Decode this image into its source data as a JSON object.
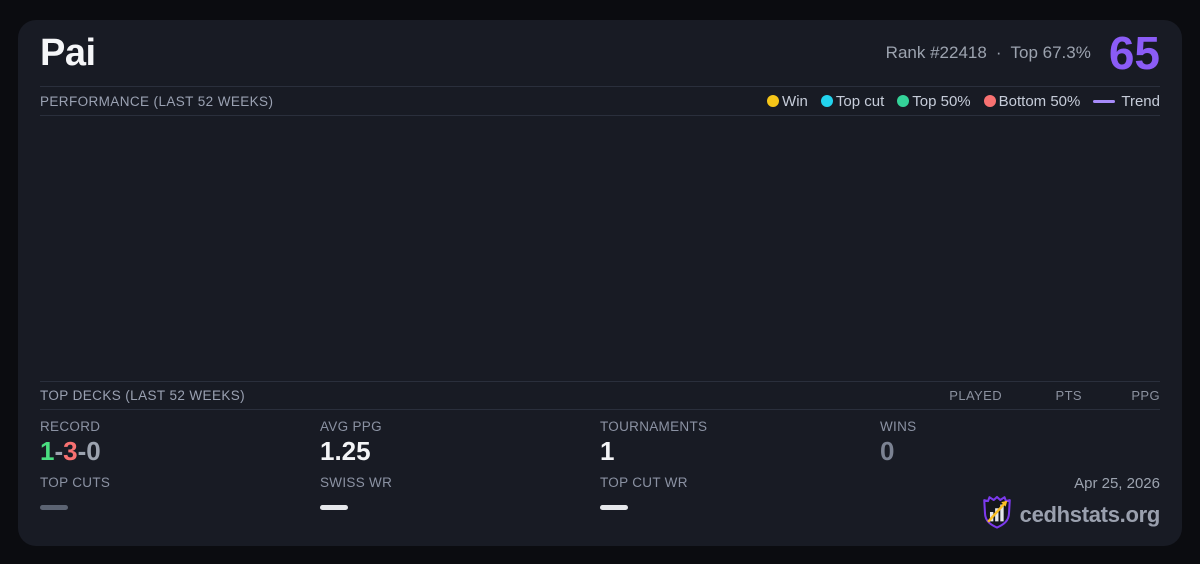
{
  "header": {
    "title": "Pai",
    "rank": "Rank #22418",
    "dot_separator": "·",
    "top_percent": "Top 67.3%",
    "score": "65",
    "score_color": "#8b5cf6"
  },
  "performance": {
    "section_title": "PERFORMANCE (LAST 52 WEEKS)",
    "legend": [
      {
        "label": "Win",
        "swatch": "background:#f5c518"
      },
      {
        "label": "Top cut",
        "swatch": "background:#22d3ee"
      },
      {
        "label": "Top 50%",
        "swatch": "background:#34d399"
      },
      {
        "label": "Bottom 50%",
        "swatch": "background:#f87171"
      },
      {
        "label": "Trend",
        "swatch": "background:#a78bfa"
      }
    ],
    "chart_points": []
  },
  "top_decks": {
    "section_title": "TOP DECKS (LAST 52 WEEKS)",
    "columns": [
      "PLAYED",
      "PTS",
      "PPG"
    ],
    "rows": []
  },
  "stats": {
    "record": {
      "label": "RECORD",
      "wins": "1",
      "losses": "3",
      "draws": "0",
      "separator": "-"
    },
    "avg_ppg": {
      "label": "AVG PPG",
      "value": "1.25"
    },
    "tournaments": {
      "label": "TOURNAMENTS",
      "value": "1"
    },
    "wins": {
      "label": "WINS",
      "value": "0"
    },
    "top_cuts": {
      "label": "TOP CUTS",
      "value": "—",
      "dash_style": "background:#5b6372"
    },
    "swiss_wr": {
      "label": "SWISS WR",
      "value": "—",
      "dash_style": "background:#e5e7eb"
    },
    "top_cut_wr": {
      "label": "TOP CUT WR",
      "value": "—",
      "dash_style": "background:#e5e7eb"
    }
  },
  "footer": {
    "date": "Apr 25, 2026",
    "brand": "cedhstats.org"
  }
}
